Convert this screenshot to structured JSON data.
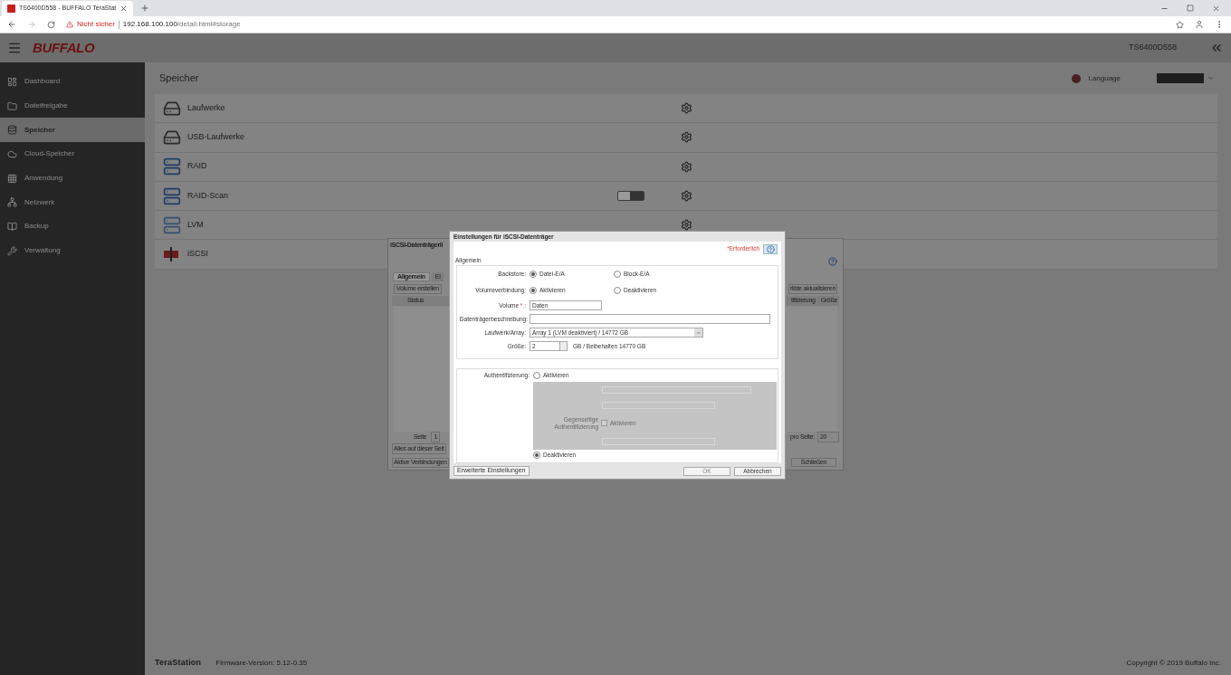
{
  "browser": {
    "tab_title": "TS6400D558 - BUFFALO TeraStat",
    "security": "Nicht sicher",
    "url_host": "192.168.100.100",
    "url_path": "/detail.html#storage"
  },
  "header": {
    "logo": "BUFFALO",
    "device": "TS6400D558",
    "language_label": "Language"
  },
  "sidebar": {
    "items": [
      {
        "label": "Dashboard",
        "kind": "dashboard",
        "selected": false
      },
      {
        "label": "Dateifreigabe",
        "kind": "folder",
        "selected": false
      },
      {
        "label": "Speicher",
        "kind": "storage",
        "selected": true
      },
      {
        "label": "Cloud-Speicher",
        "kind": "cloud",
        "selected": false
      },
      {
        "label": "Anwendung",
        "kind": "grid",
        "selected": false
      },
      {
        "label": "Netzwerk",
        "kind": "network",
        "selected": false
      },
      {
        "label": "Backup",
        "kind": "backup",
        "selected": false
      },
      {
        "label": "Verwaltung",
        "kind": "tools",
        "selected": false
      }
    ]
  },
  "page_title": "Speicher",
  "storage_items": [
    {
      "label": "Laufwerke",
      "kind": "drive"
    },
    {
      "label": "USB-Laufwerke",
      "kind": "usb"
    },
    {
      "label": "RAID",
      "kind": "raid"
    },
    {
      "label": "RAID-Scan",
      "kind": "raidscan",
      "on": false
    },
    {
      "label": "LVM",
      "kind": "lvm"
    },
    {
      "label": "iSCSI",
      "kind": "iscsi"
    }
  ],
  "list_window": {
    "title": "iSCSI-Datenträgerli",
    "tabs": [
      {
        "label": "Allgemein",
        "selected": true
      },
      {
        "label": "Ei",
        "selected": false
      }
    ],
    "create_button": "Volume erstellen",
    "refresh_button": "rliste aktualisieren",
    "columns": [
      "Status",
      "tifizierung",
      "Größe"
    ],
    "page_label": "Seite",
    "page": "1",
    "per_page_label": "pro Seite:",
    "per_page": "20",
    "select_all": "Alles auf dieser Seit",
    "connections_button": "Aktive Verbindungen",
    "close_button": "Schließen"
  },
  "dialog": {
    "title": "Einstellungen für iSCSI-Datenträger",
    "required_note": "*Erforderlich",
    "section": "Allgemein",
    "backstore": {
      "label": "Backstore:",
      "options": [
        {
          "label": "Datei-E/A",
          "selected": true
        },
        {
          "label": "Block-E/A",
          "selected": false
        }
      ]
    },
    "connection": {
      "label": "Volumeverbindung:",
      "options": [
        {
          "label": "Aktivieren",
          "selected": true
        },
        {
          "label": "Deaktivieren",
          "selected": false
        }
      ]
    },
    "volume": {
      "label": "Volume",
      "required_mark": "*",
      "suffix": ":",
      "value": "Daten"
    },
    "description": {
      "label": "Datenträgerbeschreibung:"
    },
    "array": {
      "label": "Laufwerk/Array:",
      "value": "Array 1 (LVM deaktiviert) / 14772 GB"
    },
    "size": {
      "label": "Größe:",
      "value": "2",
      "note": "GB / Beibehalten 14770 GB"
    },
    "auth": {
      "label": "Authentifizierung:",
      "options": [
        {
          "label": "Aktivieren",
          "selected": false
        },
        {
          "label": "Deaktivieren",
          "selected": true
        }
      ],
      "mutual_label": "Gegenseitige Authentifizierung",
      "mutual_option": "Aktivieren",
      "mutual_checked": false
    },
    "advanced_button": "Erweiterte Einstellungen",
    "ok_button": "OK",
    "cancel_button": "Abbrechen"
  },
  "footer": {
    "brand": "TeraStation",
    "firmware": "Firmware-Version: 5.12-0.35",
    "copyright": "Copyright © 2019 Buffalo Inc."
  }
}
